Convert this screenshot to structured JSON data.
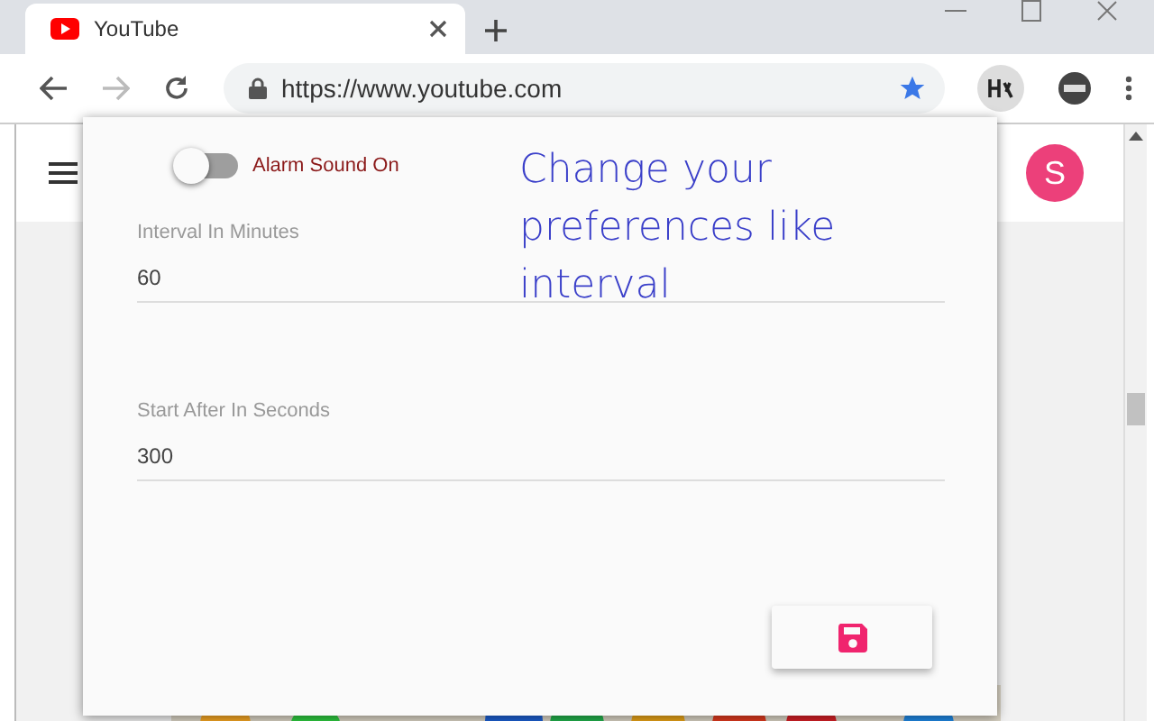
{
  "tab": {
    "title": "YouTube"
  },
  "address_bar": {
    "url": "https://www.youtube.com",
    "bookmarked": true
  },
  "page": {
    "avatar_letter": "S"
  },
  "popup": {
    "toggle": {
      "label": "Alarm Sound On",
      "on": false
    },
    "fields": [
      {
        "label": "Interval In Minutes",
        "value": "60"
      },
      {
        "label": "Start After In Seconds",
        "value": "300"
      }
    ],
    "callout": "Change your preferences like interval"
  }
}
